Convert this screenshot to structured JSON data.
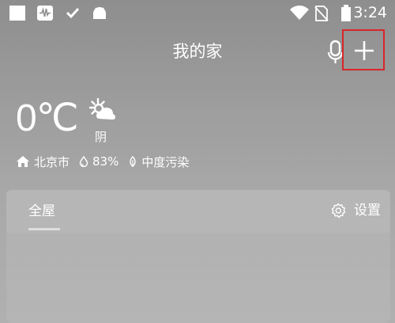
{
  "status_bar": {
    "time": "3:24",
    "icons": [
      "square-icon",
      "wave-icon",
      "check-icon",
      "android-icon",
      "wifi-icon",
      "no-sim-icon",
      "battery-icon"
    ]
  },
  "header": {
    "title": "我的家",
    "mic_icon": "microphone-icon",
    "add_icon": "plus-icon",
    "highlight_color": "#d8262a"
  },
  "weather": {
    "temperature": "0℃",
    "condition": "阴",
    "icon": "cloudy-sun-icon",
    "location": "北京市",
    "humidity": "83%",
    "pollution": "中度污染"
  },
  "card": {
    "tab_label": "全屋",
    "settings_label": "设置"
  }
}
